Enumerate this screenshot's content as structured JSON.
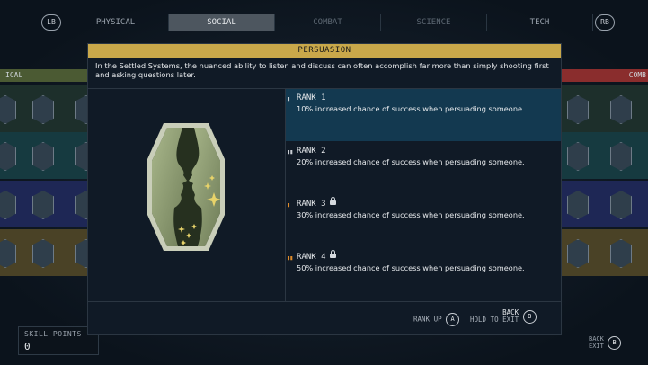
{
  "tabs": {
    "lb": "LB",
    "rb": "RB",
    "items": [
      {
        "label": "PHYSICAL",
        "state": "normal"
      },
      {
        "label": "SOCIAL",
        "state": "active"
      },
      {
        "label": "COMBAT",
        "state": "dim"
      },
      {
        "label": "SCIENCE",
        "state": "dim"
      },
      {
        "label": "TECH",
        "state": "normal"
      }
    ]
  },
  "side_headers": {
    "left": "ICAL",
    "right": "COMB"
  },
  "modal": {
    "title": "PERSUASION",
    "description": "In the Settled Systems, the nuanced ability to listen and discuss can often accomplish far more than simply shooting first and asking questions later.",
    "ranks": [
      {
        "name": "RANK 1",
        "desc": "10% increased chance of success when persuading someone.",
        "locked": false,
        "active": true
      },
      {
        "name": "RANK 2",
        "desc": "20% increased chance of success when persuading someone.",
        "locked": false,
        "active": false
      },
      {
        "name": "RANK 3",
        "desc": "30% increased chance of success when persuading someone.",
        "locked": true,
        "active": false
      },
      {
        "name": "RANK 4",
        "desc": "50% increased chance of success when persuading someone.",
        "locked": true,
        "active": false
      }
    ],
    "footer": {
      "rank_up_label": "RANK UP",
      "rank_up_button": "A",
      "back_label": "BACK",
      "hold_exit_label": "HOLD TO EXIT",
      "back_button": "B"
    }
  },
  "skill_points": {
    "label": "SKILL POINTS",
    "value": "0"
  },
  "corner": {
    "back": "BACK",
    "exit": "EXIT",
    "button": "B"
  },
  "colors": {
    "accent": "#c9a84a",
    "active_rank": "#133950",
    "locked_bars": "#e08c2a"
  }
}
